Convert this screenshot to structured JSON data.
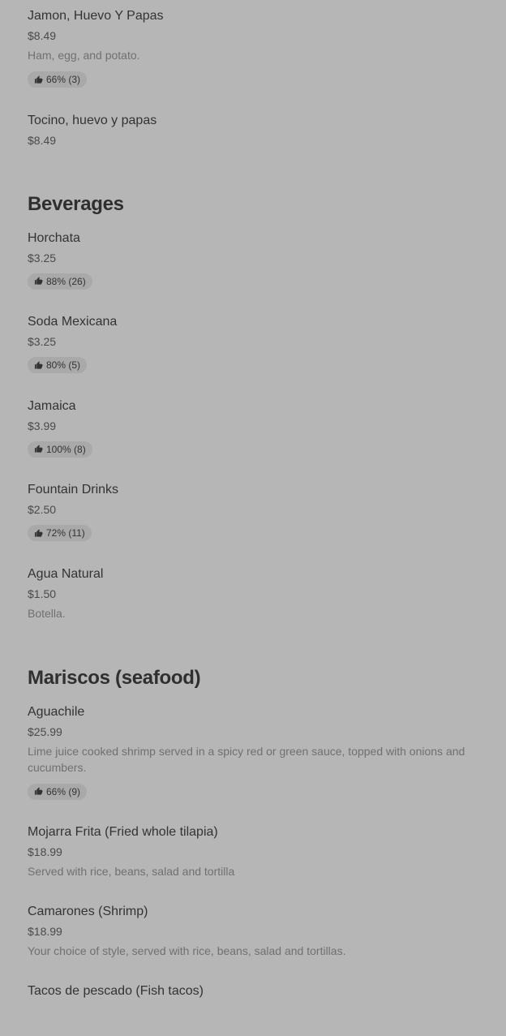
{
  "sections": [
    {
      "items": [
        {
          "name": "Jamon, Huevo Y Papas",
          "price": "$8.49",
          "description": "Ham, egg, and potato.",
          "rating": "66% (3)"
        },
        {
          "name": "Tocino, huevo y papas",
          "price": "$8.49"
        }
      ]
    },
    {
      "title": "Beverages",
      "items": [
        {
          "name": "Horchata",
          "price": "$3.25",
          "rating": "88% (26)"
        },
        {
          "name": "Soda Mexicana",
          "price": "$3.25",
          "rating": "80% (5)"
        },
        {
          "name": "Jamaica",
          "price": "$3.99",
          "rating": "100% (8)"
        },
        {
          "name": "Fountain Drinks",
          "price": "$2.50",
          "rating": "72% (11)"
        },
        {
          "name": "Agua Natural",
          "price": "$1.50",
          "description": "Botella."
        }
      ]
    },
    {
      "title": "Mariscos (seafood)",
      "items": [
        {
          "name": "Aguachile",
          "price": "$25.99",
          "description": "Lime juice cooked shrimp served in a spicy red or green sauce, topped with onions and cucumbers.",
          "rating": "66% (9)"
        },
        {
          "name": "Mojarra Frita (Fried whole tilapia)",
          "price": "$18.99",
          "description": "Served with rice, beans, salad and tortilla"
        },
        {
          "name": "Camarones (Shrimp)",
          "price": "$18.99",
          "description": "Your choice of style, served with rice, beans, salad and tortillas."
        },
        {
          "name": "Tacos de pescado (Fish tacos)",
          "price": ""
        }
      ]
    }
  ],
  "icons": {
    "rating": "thumbs-up-icon"
  },
  "colors": {
    "background": "#b6b6b6",
    "rating_pill": "#a9a9a9"
  }
}
